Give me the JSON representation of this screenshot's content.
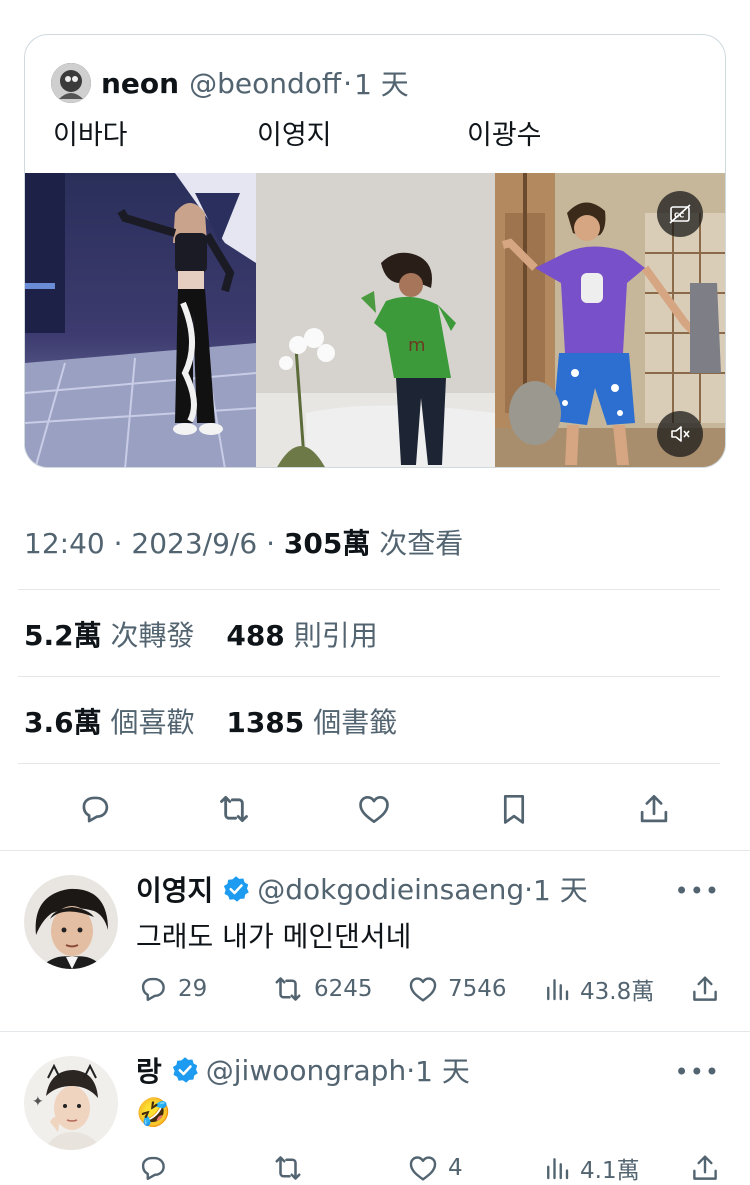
{
  "quote": {
    "author_name": "neon",
    "author_handle": "@beondoff",
    "separator": "·",
    "time": "1 天",
    "labels": [
      "이바다",
      "이영지",
      "이광수"
    ]
  },
  "tweet_meta": {
    "time": "12:40",
    "dot1": "·",
    "date": "2023/9/6",
    "dot2": "·",
    "views_count": "305萬",
    "views_label": "次查看"
  },
  "stats": {
    "retweets_count": "5.2萬",
    "retweets_label": "次轉發",
    "quotes_count": "488",
    "quotes_label": "則引用",
    "likes_count": "3.6萬",
    "likes_label": "個喜歡",
    "bookmarks_count": "1385",
    "bookmarks_label": "個書籤"
  },
  "actions": [
    "reply-icon",
    "retweet-icon",
    "like-icon",
    "bookmark-icon",
    "share-icon"
  ],
  "replies": [
    {
      "name": "이영지",
      "handle": "@dokgodieinsaeng",
      "separator": "·",
      "time": "1 天",
      "text": "그래도 내가 메인댄서네",
      "more": "•••",
      "replies": "29",
      "retweets": "6245",
      "likes": "7546",
      "views": "43.8萬"
    },
    {
      "name": "랑",
      "handle": "@jiwoongraph",
      "separator": "·",
      "time": "1 天",
      "text": "🤣",
      "more": "•••",
      "replies": "",
      "retweets": "",
      "likes": "4",
      "views": "4.1萬"
    }
  ],
  "colors": {
    "text": "#0f1419",
    "secondary": "#536471",
    "border": "#cfd9de",
    "verified": "#1d9bf0"
  }
}
